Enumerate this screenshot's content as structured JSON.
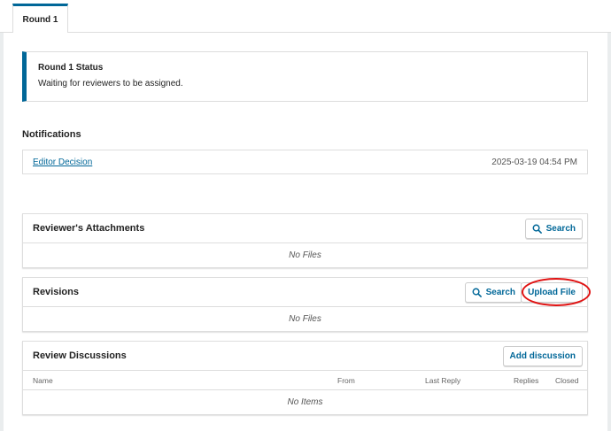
{
  "tabs": [
    {
      "label": "Round 1"
    }
  ],
  "status": {
    "title": "Round 1 Status",
    "text": "Waiting for reviewers to be assigned."
  },
  "notifications": {
    "heading": "Notifications",
    "items": [
      {
        "label": "Editor Decision",
        "date": "2025-03-19 04:54 PM"
      }
    ]
  },
  "reviewer_attachments": {
    "title": "Reviewer's Attachments",
    "search_label": "Search",
    "empty": "No Files"
  },
  "revisions": {
    "title": "Revisions",
    "search_label": "Search",
    "upload_label": "Upload File",
    "empty": "No Files"
  },
  "review_discussions": {
    "title": "Review Discussions",
    "add_label": "Add discussion",
    "columns": [
      "Name",
      "From",
      "Last Reply",
      "Replies",
      "Closed"
    ],
    "empty": "No Items"
  },
  "colors": {
    "accent": "#006798",
    "highlight": "#e01212"
  },
  "icons": {
    "search": "search-icon"
  }
}
